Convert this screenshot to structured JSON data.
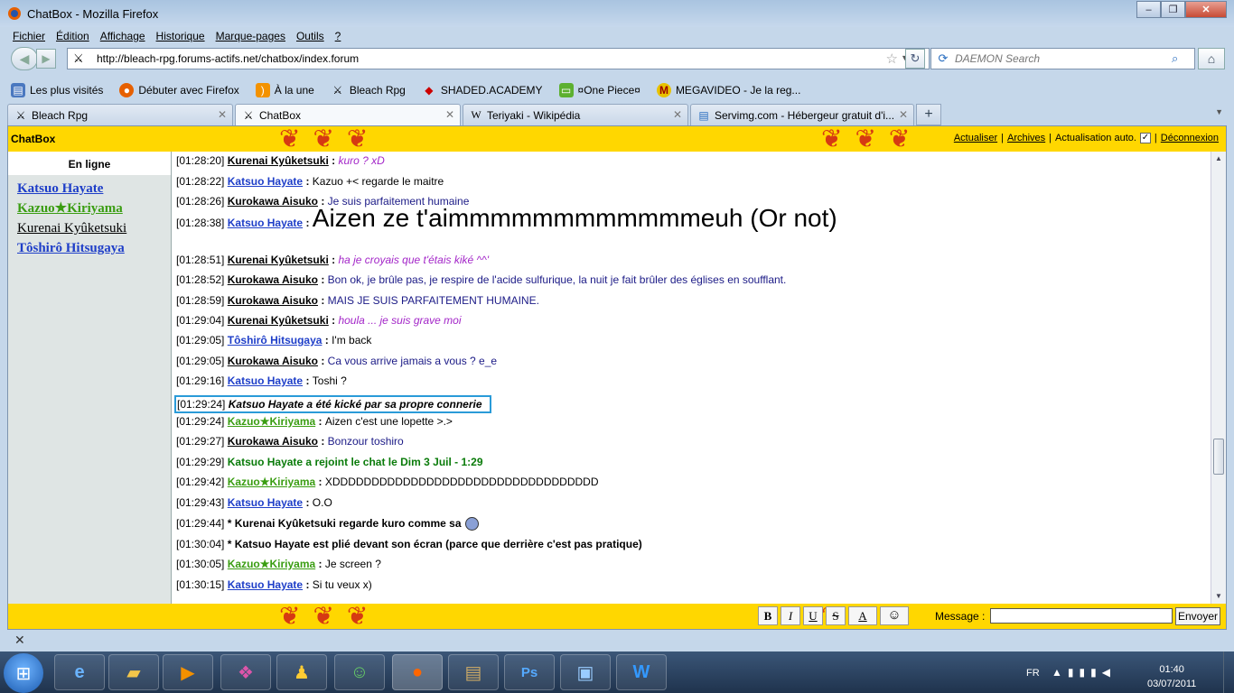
{
  "window": {
    "title": "ChatBox - Mozilla Firefox"
  },
  "menu": [
    "Fichier",
    "Édition",
    "Affichage",
    "Historique",
    "Marque-pages",
    "Outils",
    "?"
  ],
  "nav": {
    "url": "http://bleach-rpg.forums-actifs.net/chatbox/index.forum",
    "search_placeholder": "DAEMON Search"
  },
  "bookmarks": [
    {
      "label": "Les plus visités",
      "icon": "bookmark-icon"
    },
    {
      "label": "Débuter avec Firefox",
      "icon": "firefox-icon"
    },
    {
      "label": "À la une",
      "icon": "rss-icon"
    },
    {
      "label": "Bleach Rpg",
      "icon": "bleach-icon"
    },
    {
      "label": "SHADED.ACADEMY",
      "icon": "shaded-icon"
    },
    {
      "label": "¤One Piece¤",
      "icon": "chat-icon"
    },
    {
      "label": "MEGAVIDEO - Je la reg...",
      "icon": "megavideo-icon"
    }
  ],
  "tabs": [
    {
      "label": "Bleach Rpg",
      "icon": "bleach-icon"
    },
    {
      "label": "ChatBox",
      "icon": "bleach-icon"
    },
    {
      "label": "Teriyaki - Wikipédia",
      "icon": "wikipedia-icon"
    },
    {
      "label": "Servimg.com - Hébergeur gratuit d'i...",
      "icon": "servimg-icon"
    }
  ],
  "chatbox": {
    "brand": "ChatBox",
    "links": {
      "refresh": "Actualiser",
      "archives": "Archives",
      "auto": "Actualisation auto.",
      "logout": "Déconnexion"
    },
    "online_header": "En ligne",
    "online_users": [
      {
        "name": "Katsuo Hayate",
        "color": "#1e3ec8"
      },
      {
        "name": "Kazuo★Kiriyama",
        "color": "#3a9d12"
      },
      {
        "name": "Kurenai Kyûketsuki",
        "color": "#000000"
      },
      {
        "name": "Tôshirô Hitsugaya",
        "color": "#1e3ec8"
      }
    ],
    "messages": [
      {
        "ts": "[01:28:20]",
        "user": "Kurenai Kyûketsuki",
        "ucolor": "c-black",
        "sep": " : ",
        "text": "kuro ? xD",
        "tclass": "c-purple"
      },
      {
        "ts": "[01:28:22]",
        "user": "Katsuo Hayate",
        "ucolor": "c-blue",
        "sep": " : ",
        "text": "Kazuo +< regarde le maitre",
        "tclass": "c-black"
      },
      {
        "ts": "[01:28:26]",
        "user": "Kurokawa Aisuko",
        "ucolor": "c-black",
        "sep": " : ",
        "text": "Je suis parfaitement humaine",
        "tclass": "c-navy"
      },
      {
        "ts": "[01:28:38]",
        "user": "Katsuo Hayate",
        "ucolor": "c-blue",
        "sep": " : ",
        "text": "Aizen ze t'aimmmmmmmmmmmmeuh (Or not)",
        "tclass": "big"
      },
      {
        "ts": "[01:28:51]",
        "user": "Kurenai Kyûketsuki",
        "ucolor": "c-black",
        "sep": " : ",
        "text": "ha je croyais que t'étais kiké ^^'",
        "tclass": "c-purple"
      },
      {
        "ts": "[01:28:52]",
        "user": "Kurokawa Aisuko",
        "ucolor": "c-black",
        "sep": " : ",
        "text": "Bon ok, je brûle pas, je respire de l'acide sulfurique, la nuit je fait brûler des églises en soufflant.",
        "tclass": "c-navy"
      },
      {
        "ts": "[01:28:59]",
        "user": "Kurokawa Aisuko",
        "ucolor": "c-black",
        "sep": " : ",
        "text": "MAIS JE SUIS PARFAITEMENT HUMAINE.",
        "tclass": "c-navy"
      },
      {
        "ts": "[01:29:04]",
        "user": "Kurenai Kyûketsuki",
        "ucolor": "c-black",
        "sep": " : ",
        "text": "houla ... je suis grave moi",
        "tclass": "c-purple"
      },
      {
        "ts": "[01:29:05]",
        "user": "Tôshirô Hitsugaya",
        "ucolor": "c-blue",
        "sep": " : ",
        "text": "I'm back",
        "tclass": "c-black"
      },
      {
        "ts": "[01:29:05]",
        "user": "Kurokawa Aisuko",
        "ucolor": "c-black",
        "sep": " : ",
        "text": "Ca vous arrive jamais a vous ? e_e",
        "tclass": "c-navy"
      },
      {
        "ts": "[01:29:16]",
        "user": "Katsuo Hayate",
        "ucolor": "c-blue",
        "sep": " : ",
        "text": "Toshi ?",
        "tclass": "c-black"
      },
      {
        "ts": "[01:29:24]",
        "user": "",
        "ucolor": "",
        "sep": " ",
        "text": "Katsuo Hayate a été kické par sa propre connerie",
        "tclass": "kick"
      },
      {
        "ts": "[01:29:24]",
        "user": "Kazuo★Kiriyama",
        "ucolor": "c-green",
        "sep": " : ",
        "text": "Aizen c'est une lopette >.>",
        "tclass": "c-black"
      },
      {
        "ts": "[01:29:27]",
        "user": "Kurokawa Aisuko",
        "ucolor": "c-black",
        "sep": " : ",
        "text": "Bonzour toshiro",
        "tclass": "c-navy"
      },
      {
        "ts": "[01:29:29]",
        "user": "",
        "ucolor": "",
        "sep": " ",
        "text": "Katsuo Hayate a rejoint le chat le Dim 3 Juil - 1:29",
        "tclass": "c-sys"
      },
      {
        "ts": "[01:29:42]",
        "user": "Kazuo★Kiriyama",
        "ucolor": "c-green",
        "sep": " : ",
        "text": "XDDDDDDDDDDDDDDDDDDDDDDDDDDDDDDDDDD",
        "tclass": "c-black"
      },
      {
        "ts": "[01:29:43]",
        "user": "Katsuo Hayate",
        "ucolor": "c-blue",
        "sep": " : ",
        "text": "O.O",
        "tclass": "c-black"
      },
      {
        "ts": "[01:29:44]",
        "user": "",
        "ucolor": "",
        "sep": " ",
        "text": "* Kurenai Kyûketsuki regarde kuro comme sa",
        "tclass": "action"
      },
      {
        "ts": "[01:30:04]",
        "user": "",
        "ucolor": "",
        "sep": " ",
        "text": "* Katsuo Hayate est plié devant son écran (parce que derrière c'est pas pratique)",
        "tclass": "action"
      },
      {
        "ts": "[01:30:05]",
        "user": "Kazuo★Kiriyama",
        "ucolor": "c-green",
        "sep": " : ",
        "text": "Je screen ?",
        "tclass": "c-black"
      },
      {
        "ts": "[01:30:15]",
        "user": "Katsuo Hayate",
        "ucolor": "c-blue",
        "sep": " : ",
        "text": "Si tu veux x)",
        "tclass": "c-black"
      }
    ],
    "format_buttons": [
      "B",
      "I",
      "U",
      "S",
      "A",
      "☺"
    ],
    "message_label": "Message :",
    "send_label": "Envoyer"
  },
  "taskbar": {
    "lang": "FR",
    "time": "01:40",
    "date": "03/07/2011"
  },
  "colors": {
    "yellow": "#ffd700",
    "butterfly": "#d63a12",
    "highlight": "#2a9bd8"
  }
}
